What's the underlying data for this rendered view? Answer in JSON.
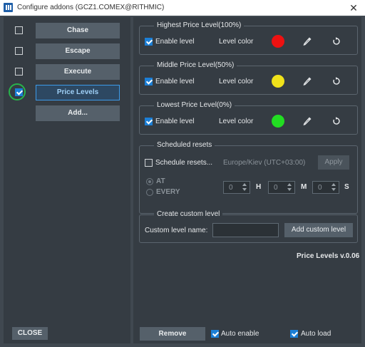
{
  "window": {
    "title": "Configure addons (GCZ1.COMEX@RITHMIC)",
    "close_glyph": "✕"
  },
  "addons": [
    {
      "label": "Chase",
      "checked": false
    },
    {
      "label": "Escape",
      "checked": false
    },
    {
      "label": "Execute",
      "checked": false
    },
    {
      "label": "Price Levels",
      "checked": true
    }
  ],
  "add_button": "Add...",
  "close_button": "CLOSE",
  "levels": [
    {
      "title": "Highest Price Level(100%)",
      "enable_label": "Enable level",
      "enabled": true,
      "color_label": "Level color",
      "color": "#ee1111"
    },
    {
      "title": "Middle Price Level(50%)",
      "enable_label": "Enable level",
      "enabled": true,
      "color_label": "Level color",
      "color": "#f0e21a"
    },
    {
      "title": "Lowest Price Level(0%)",
      "enable_label": "Enable level",
      "enabled": true,
      "color_label": "Level color",
      "color": "#22dd22"
    }
  ],
  "icons": {
    "picker": "eyedropper-icon",
    "reset": "reset-icon"
  },
  "scheduled": {
    "title": "Scheduled resets",
    "schedule_label": "Schedule resets...",
    "timezone": "Europe/Kiev (UTC+03:00)",
    "apply": "Apply",
    "at": "AT",
    "every": "EVERY",
    "hours": "0",
    "h": "H",
    "minutes": "0",
    "m": "M",
    "seconds": "0",
    "s": "S"
  },
  "custom": {
    "title": "Create custom level",
    "name_label": "Custom level name:",
    "name_value": "",
    "add_button": "Add custom level"
  },
  "version": "Price Levels v.0.06",
  "bottom": {
    "remove": "Remove",
    "auto_enable": "Auto enable",
    "auto_load": "Auto load"
  }
}
